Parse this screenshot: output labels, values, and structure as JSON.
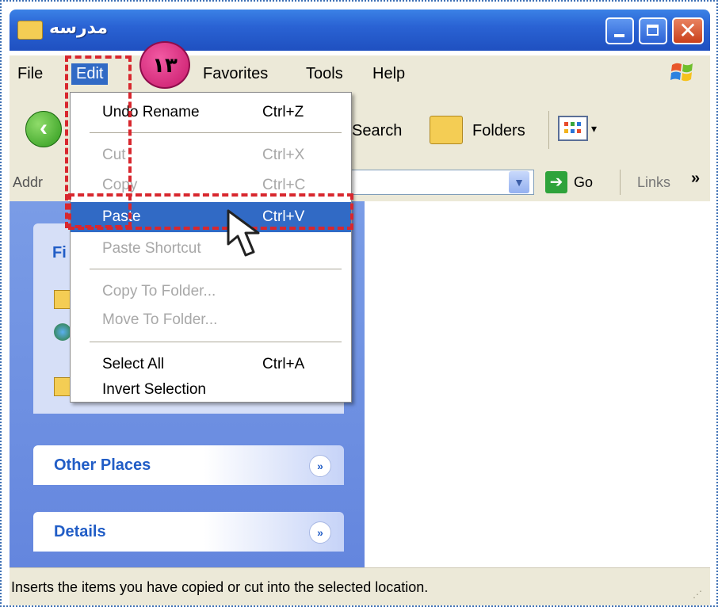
{
  "window": {
    "title": "مدرسه",
    "controls": {
      "minimize": "minimize",
      "maximize": "maximize",
      "close": "✕"
    }
  },
  "menubar": {
    "items": [
      "File",
      "Edit",
      "Favorites",
      "Tools",
      "Help"
    ],
    "active": "Edit"
  },
  "toolbar": {
    "search_label": "Search",
    "folders_label": "Folders"
  },
  "addressbar": {
    "label": "Addr",
    "go_label": "Go",
    "links_label": "Links",
    "links_chevron": "»"
  },
  "edit_menu": {
    "items": [
      {
        "label": "Undo Rename",
        "shortcut": "Ctrl+Z",
        "enabled": true
      },
      {
        "label": "Cut",
        "shortcut": "Ctrl+X",
        "enabled": false
      },
      {
        "label": "Copy",
        "shortcut": "Ctrl+C",
        "enabled": false
      },
      {
        "label": "Paste",
        "shortcut": "Ctrl+V",
        "enabled": true,
        "highlighted": true
      },
      {
        "label": "Paste Shortcut",
        "shortcut": "",
        "enabled": false
      },
      {
        "label": "Copy To Folder...",
        "shortcut": "",
        "enabled": false
      },
      {
        "label": "Move To Folder...",
        "shortcut": "",
        "enabled": false
      },
      {
        "label": "Select All",
        "shortcut": "Ctrl+A",
        "enabled": true
      },
      {
        "label": "Invert Selection",
        "shortcut": "",
        "enabled": true
      }
    ]
  },
  "taskpane": {
    "file_tasks_partial": "Fi",
    "other_places": "Other Places",
    "details": "Details",
    "chevron": "»"
  },
  "annotation": {
    "step_number": "۱۳"
  },
  "statusbar": {
    "text": "Inserts the items you have copied or cut into the selected location."
  },
  "colors": {
    "titlebar": "#2a63d4",
    "menu_highlight": "#316ac5",
    "taskpane": "#6f93e2",
    "annotation_red": "#d8272e",
    "step_badge": "#e0338a"
  }
}
